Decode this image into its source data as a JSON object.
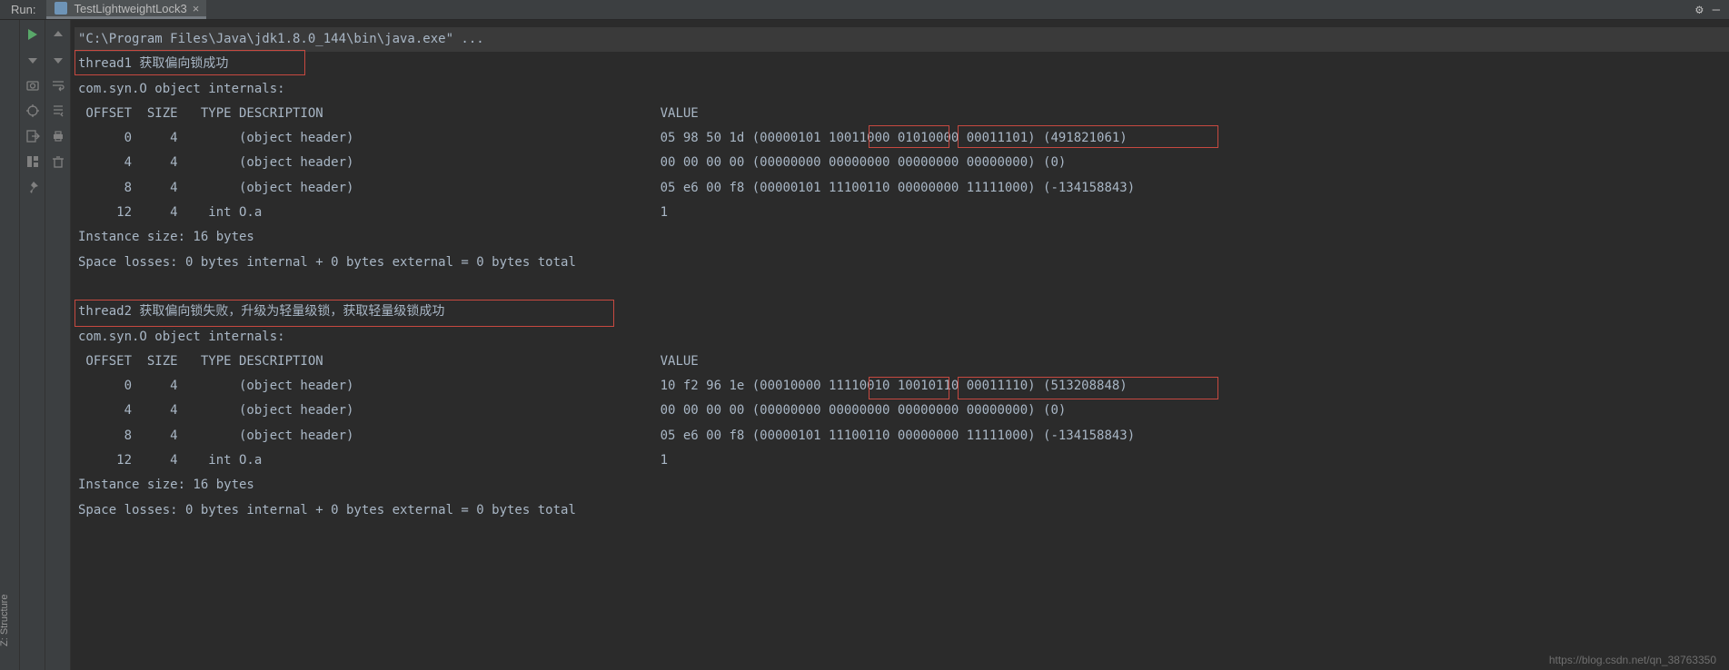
{
  "header": {
    "run_label": "Run:",
    "tab_title": "TestLightweightLock3",
    "gear": "⚙",
    "minimize": "—"
  },
  "sidebar": {
    "vertical_label": "Z: Structure"
  },
  "console": {
    "cmd": "\"C:\\Program Files\\Java\\jdk1.8.0_144\\bin\\java.exe\" ...",
    "t1": "thread1 获取偏向锁成功",
    "internals": "com.syn.O object internals:",
    "hdr": " OFFSET  SIZE   TYPE DESCRIPTION                                            VALUE",
    "r1a": "      0     4        (object header)                                        05 98 50 1d (00000101 10011000 01010000 00011101) (491821061)",
    "r1b": "      4     4        (object header)                                        00 00 00 00 (00000000 00000000 00000000 00000000) (0)",
    "r1c": "      8     4        (object header)                                        05 e6 00 f8 (00000101 11100110 00000000 11111000) (-134158843)",
    "r1d": "     12     4    int O.a                                                    1",
    "inst": "Instance size: 16 bytes",
    "losses": "Space losses: 0 bytes internal + 0 bytes external = 0 bytes total",
    "blank": " ",
    "t2": "thread2 获取偏向锁失败，升级为轻量级锁，获取轻量级锁成功",
    "r2a": "      0     4        (object header)                                        10 f2 96 1e (00010000 11110010 10010110 00011110) (513208848)",
    "r2b": "      4     4        (object header)                                        00 00 00 00 (00000000 00000000 00000000 00000000) (0)",
    "r2c": "      8     4        (object header)                                        05 e6 00 f8 (00000101 11100110 00000000 11111000) (-134158843)",
    "r2d": "     12     4    int O.a                                                    1"
  },
  "watermark": "https://blog.csdn.net/qn_38763350"
}
